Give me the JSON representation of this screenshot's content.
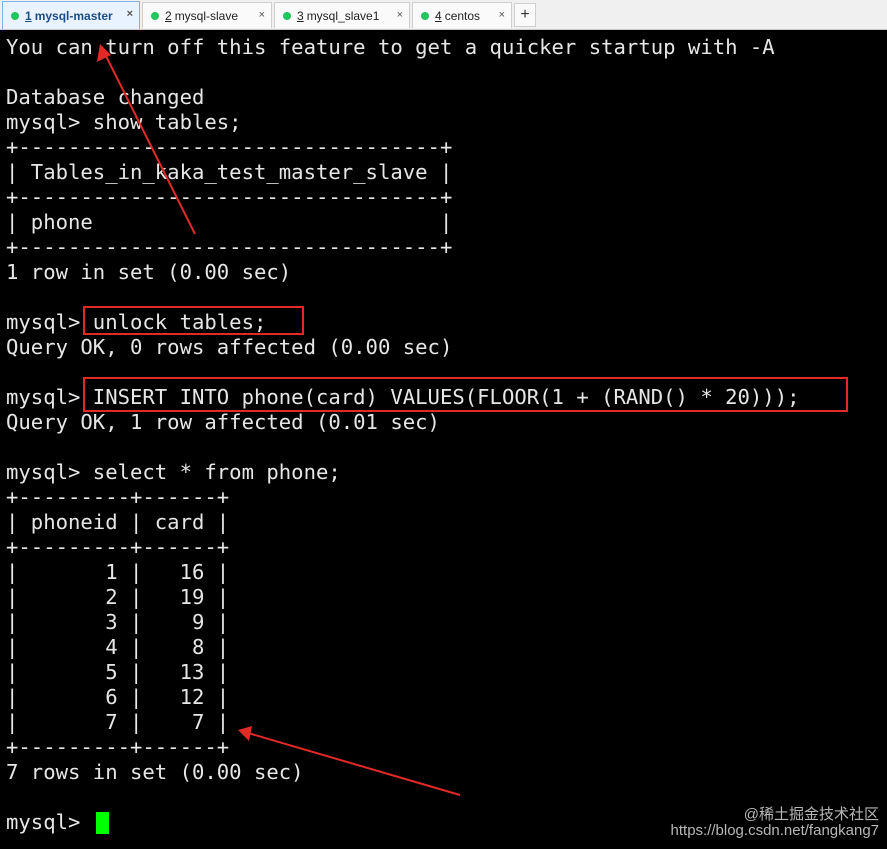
{
  "tabs": [
    {
      "num": "1",
      "label": "mysql-master",
      "close": "×",
      "dot_color": "#22c55e"
    },
    {
      "num": "2",
      "label": "mysql-slave",
      "close": "×",
      "dot_color": "#22c55e"
    },
    {
      "num": "3",
      "label": "mysql_slave1",
      "close": "×",
      "dot_color": "#22c55e"
    },
    {
      "num": "4",
      "label": "centos",
      "close": "×",
      "dot_color": "#22c55e"
    }
  ],
  "add_tab_label": "+",
  "terminal": {
    "lines": [
      "You can turn off this feature to get a quicker startup with -A",
      "",
      "Database changed",
      "mysql> show tables;",
      "+----------------------------------+",
      "| Tables_in_kaka_test_master_slave |",
      "+----------------------------------+",
      "| phone                            |",
      "+----------------------------------+",
      "1 row in set (0.00 sec)",
      "",
      "mysql> unlock tables;",
      "Query OK, 0 rows affected (0.00 sec)",
      "",
      "mysql> INSERT INTO phone(card) VALUES(FLOOR(1 + (RAND() * 20)));",
      "Query OK, 1 row affected (0.01 sec)",
      "",
      "mysql> select * from phone;",
      "+---------+------+",
      "| phoneid | card |",
      "+---------+------+",
      "|       1 |   16 |",
      "|       2 |   19 |",
      "|       3 |    9 |",
      "|       4 |    8 |",
      "|       5 |   13 |",
      "|       6 |   12 |",
      "|       7 |    7 |",
      "+---------+------+",
      "7 rows in set (0.00 sec)",
      "",
      "mysql> "
    ],
    "cursor_color": "#00ff00",
    "text_color": "#e6e6e6"
  },
  "annotation_color": "#e12a26",
  "watermark": {
    "line1": "@稀土掘金技术社区",
    "line2": "https://blog.csdn.net/fangkang7"
  }
}
